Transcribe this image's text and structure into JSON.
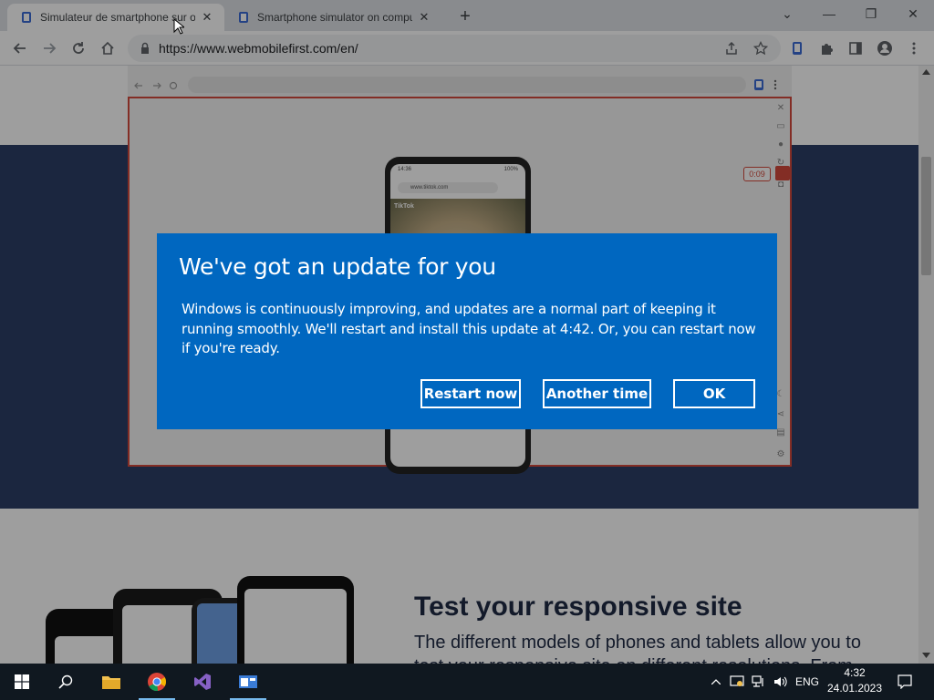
{
  "browser": {
    "tabs": [
      {
        "title": "Simulateur de smartphone sur ordinateur",
        "close": "✕"
      },
      {
        "title": "Smartphone simulator on computer",
        "close": "✕"
      }
    ],
    "new_tab": "+",
    "url": "https://www.webmobilefirst.com/en/",
    "window_controls": {
      "dropdown": "⌄",
      "minimize": "—",
      "restore": "❐",
      "close": "✕"
    }
  },
  "simulator": {
    "timer": "0:09",
    "phone_url": "www.tiktok.com",
    "phone_status_time": "14:36",
    "phone_status_battery": "100%",
    "phone_app_label": "TikTok"
  },
  "page": {
    "section_title": "Test your responsive site",
    "section_text": "The different models of phones and tablets allow you to test your responsive site on different resolutions. From"
  },
  "dialog": {
    "title": "We've got an update for you",
    "message": "Windows is continuously improving, and updates are a normal part of keeping it running smoothly. We'll restart and install this update at 4:42. Or, you can restart now if you're ready.",
    "buttons": {
      "restart": "Restart now",
      "another_time": "Another time",
      "ok": "OK"
    }
  },
  "taskbar": {
    "language": "ENG",
    "time": "4:32",
    "date": "24.01.2023"
  },
  "colors": {
    "dialog_bg": "#0067c0",
    "hero_bg": "#2c3e66",
    "accent_red": "#d34a3c",
    "taskbar_bg": "#101820"
  }
}
